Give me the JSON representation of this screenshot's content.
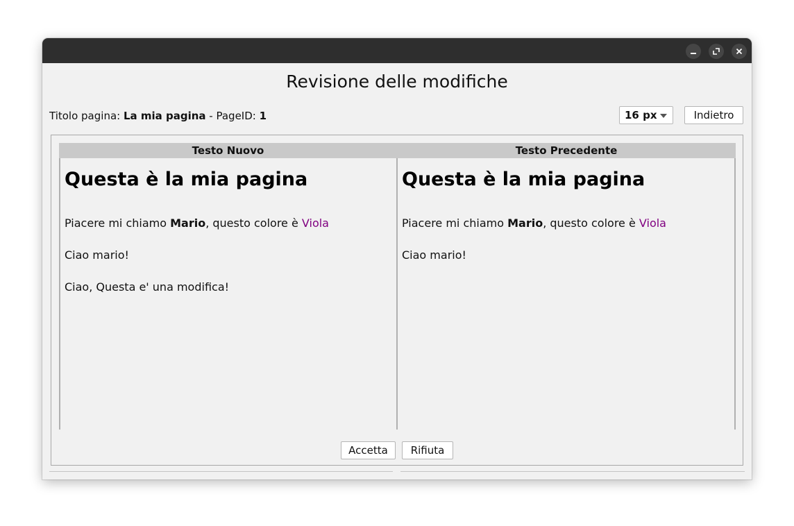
{
  "window": {
    "controls": {
      "minimize_icon": "minimize-icon",
      "maximize_icon": "maximize-icon",
      "close_icon": "close-icon"
    }
  },
  "dialog": {
    "title": "Revisione delle modifiche"
  },
  "page_info": {
    "title_label": "Titolo pagina: ",
    "title_value": "La mia pagina",
    "separator": " - PageID: ",
    "page_id": "1"
  },
  "toolbar": {
    "font_size_value": "16 px",
    "back_label": "Indietro"
  },
  "compare": {
    "new": {
      "header": "Testo Nuovo",
      "heading": "Questa è la mia pagina",
      "p1_prefix": "Piacere mi chiamo ",
      "p1_bold": "Mario",
      "p1_middle": ", questo colore è ",
      "p1_colored": "Viola",
      "p2": "Ciao mario!",
      "p3_added": "Ciao, Questa e' una modifica!"
    },
    "old": {
      "header": "Testo Precedente",
      "heading": "Questa è la mia pagina",
      "p1_prefix": "Piacere mi chiamo ",
      "p1_bold": "Mario",
      "p1_middle": ", questo colore è ",
      "p1_colored": "Viola",
      "p2": "Ciao mario!"
    }
  },
  "actions": {
    "accept_label": "Accetta",
    "reject_label": "Rifiuta"
  },
  "colors": {
    "titlebar": "#2e2e2e",
    "window_bg": "#f1f1f1",
    "header_bg": "#c9c9c9",
    "viola_text": "#800080",
    "added_text": "#008000"
  }
}
